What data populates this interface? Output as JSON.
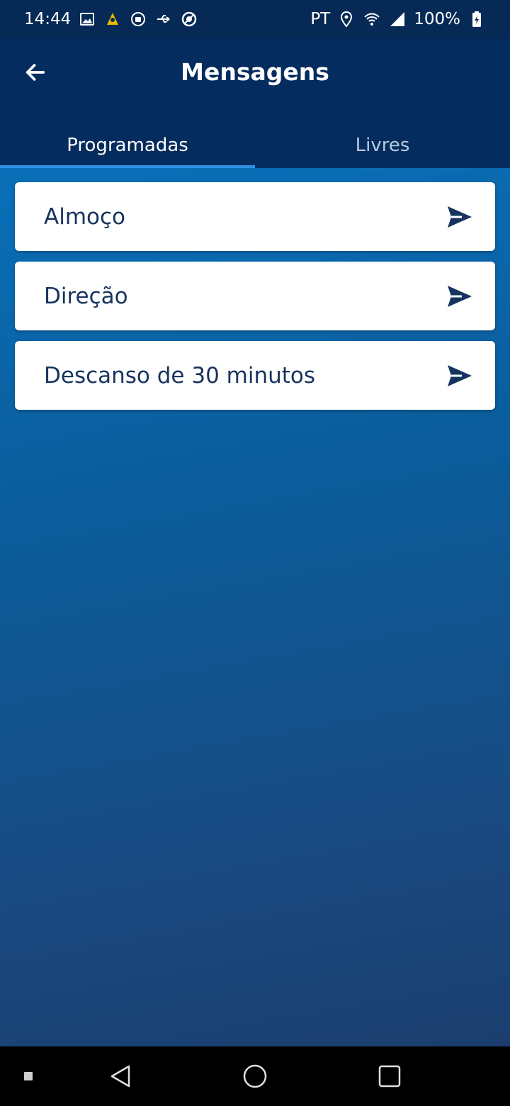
{
  "status_bar": {
    "time": "14:44",
    "carrier": "PT",
    "battery": "100%",
    "icons_left": [
      "image-icon",
      "app-notification-icon",
      "android-icon",
      "usb-icon",
      "blocked-icon"
    ],
    "icons_right": [
      "location-icon",
      "wifi-icon",
      "signal-icon",
      "battery-icon"
    ]
  },
  "header": {
    "title": "Mensagens",
    "back_icon": "arrow-left-icon"
  },
  "tabs": [
    {
      "label": "Programadas",
      "active": true
    },
    {
      "label": "Livres",
      "active": false
    }
  ],
  "messages": [
    {
      "label": "Almoço",
      "icon": "send-icon"
    },
    {
      "label": "Direção",
      "icon": "send-icon"
    },
    {
      "label": "Descanso de 30 minutos",
      "icon": "send-icon"
    }
  ],
  "nav_bar": {
    "buttons": [
      "recents-dot",
      "back-triangle",
      "home-circle",
      "overview-square"
    ]
  },
  "colors": {
    "status_bar": "#062a55",
    "header": "#052c5e",
    "tab_indicator": "#2f8fe0",
    "card_text": "#16345f",
    "background_top": "#0a6fb8",
    "background_bottom": "#1b3e6e"
  }
}
